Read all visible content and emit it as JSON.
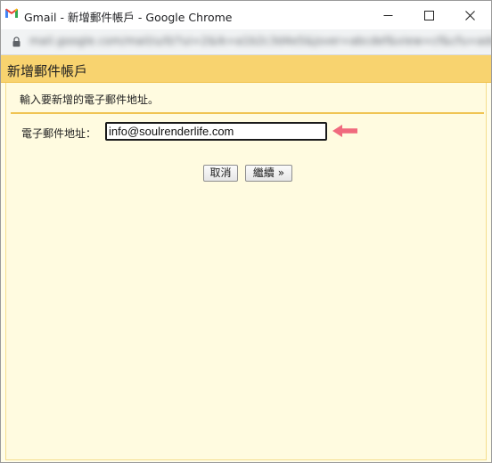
{
  "window": {
    "title": "Gmail - 新增郵件帳戶 - Google Chrome",
    "controls": {
      "minimize_icon": "minimize-icon",
      "maximize_icon": "maximize-icon",
      "close_icon": "close-icon"
    }
  },
  "address_bar": {
    "url": "mail.google.com/mail/u/0/?ui=2&ik=a1b2c3d4e5&jsver=abcdef&view=cf&cfu=add"
  },
  "page": {
    "header_title": "新增郵件帳戶",
    "instruction": "輸入要新增的電子郵件地址。",
    "email_label": "電子郵件地址：",
    "email_value": "info@soulrenderlife.com",
    "cancel_label": "取消",
    "next_label": "繼續 »"
  },
  "annotation": {
    "arrow_icon": "arrow-left-icon",
    "arrow_color": "#f06a7e"
  },
  "colors": {
    "header_bg": "#f8d36f",
    "page_bg": "#fffbe0",
    "divider": "#f0c453"
  }
}
